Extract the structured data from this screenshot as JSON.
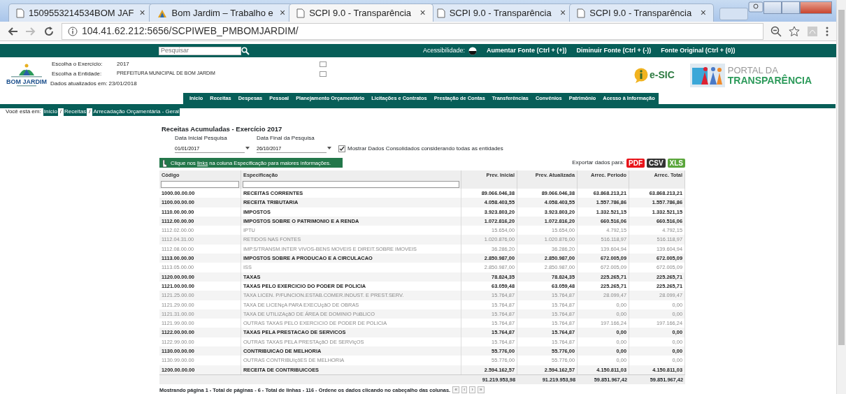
{
  "browser": {
    "tabs": [
      {
        "label": "1509553214534BOM JAF",
        "selected": false
      },
      {
        "label": "Bom Jardim – Trabalho e",
        "selected": false
      },
      {
        "label": "SCPI 9.0 - Transparência",
        "selected": true
      },
      {
        "label": "SCPI 9.0 - Transparência",
        "selected": false
      },
      {
        "label": "SCPI 9.0 - Transparência",
        "selected": false
      }
    ],
    "close_glyph": "×",
    "address": "104.41.62.212:5656/SCPIWEB_PMBOMJARDIM/"
  },
  "topbar": {
    "search_placeholder": "Pesquisar",
    "accessibility_label": "Acessibilidade:",
    "font_links": [
      "Aumentar Fonte (Ctrl + (+))",
      "Diminuir Fonte (Ctrl + (-))",
      "Fonte Original (Ctrl + (0))"
    ]
  },
  "header": {
    "logo_title": "BOM JARDIM",
    "fields": [
      {
        "label": "Escolha o Exercício:",
        "value": "2017"
      },
      {
        "label": "Escolha a Entidade:",
        "value": "PREFEITURA MUNICIPAL DE BOM JARDIM"
      }
    ],
    "updated": "Dados atualizados em: 23/01/2018",
    "esic": "e-SIC",
    "portal": [
      "PORTAL DA",
      "TRANSPARÊNCIA"
    ]
  },
  "nav": [
    "Inicio",
    "Receitas",
    "Despesas",
    "Pessoal",
    "Planejamento Orçamentário",
    "Licitações e Contratos",
    "Prestação de Contas",
    "Transferências",
    "Convênios",
    "Patrimônio",
    "Acesso à Informação"
  ],
  "breadcrumb": {
    "label": "Você está em:",
    "separator": "/",
    "items": [
      "Início",
      "Receitas",
      "Arrecadação Orçamentária - Geral"
    ]
  },
  "report": {
    "title": "Receitas Acumuladas - Exercício 2017",
    "date_fields": [
      {
        "label": "Data Inicial Pesquisa",
        "value": "01/01/2017"
      },
      {
        "label": "Data Final da Pesquisa",
        "value": "26/10/2017"
      }
    ],
    "consolidated": {
      "label": "Mostrar Dados Consolidados considerando todas as entidades",
      "checked": true
    },
    "hint": "Clique nos **links** na coluna Especificação para maiores informações.",
    "export_label": "Exportar dados para:",
    "export_buttons": [
      {
        "label": "PDF",
        "color": "#e8151b"
      },
      {
        "label": "CSV",
        "color": "#333333"
      },
      {
        "label": "XLS",
        "color": "#5ba63c"
      }
    ]
  },
  "table": {
    "columns": [
      "Código",
      "Especificação",
      "Prev. Inicial",
      "Prev. Atualizada",
      "Arrec. Periodo",
      "Arrec. Total"
    ],
    "rows": [
      {
        "kind": "summary",
        "cells": [
          "1000.00.00.00",
          "RECEITAS CORRENTES",
          "89.066.046,38",
          "89.066.046,38",
          "63.868.213,21",
          "63.868.213,21"
        ]
      },
      {
        "kind": "summary",
        "cells": [
          "1100.00.00.00",
          "RECEITA TRIBUTARIA",
          "4.058.403,55",
          "4.058.403,55",
          "1.557.786,86",
          "1.557.786,86"
        ]
      },
      {
        "kind": "summary",
        "cells": [
          "1110.00.00.00",
          "IMPOSTOS",
          "3.923.803,20",
          "3.923.803,20",
          "1.332.521,15",
          "1.332.521,15"
        ]
      },
      {
        "kind": "summary",
        "cells": [
          "1112.00.00.00",
          "IMPOSTOS SOBRE O PATRIMONIO E A RENDA",
          "1.072.816,20",
          "1.072.816,20",
          "660.516,06",
          "660.516,06"
        ]
      },
      {
        "kind": "detail",
        "cells": [
          "1112.02.00.00",
          "IPTU",
          "15.654,00",
          "15.654,00",
          "4.792,15",
          "4.792,15"
        ]
      },
      {
        "kind": "detail",
        "cells": [
          "1112.04.31.00",
          "RETIDOS NAS FONTES",
          "1.020.876,00",
          "1.020.876,00",
          "516.118,97",
          "516.118,97"
        ]
      },
      {
        "kind": "detail",
        "cells": [
          "1112.08.00.00",
          "IMP.S/TRANSM.INTER VIVOS-BENS MOVEIS E DIREIT.SOBRE IMOVEIS",
          "36.286,20",
          "36.286,20",
          "139.604,94",
          "139.604,94"
        ]
      },
      {
        "kind": "summary",
        "cells": [
          "1113.00.00.00",
          "IMPOSTOS SOBRE A PRODUCAO E A CIRCULACAO",
          "2.850.987,00",
          "2.850.987,00",
          "672.005,09",
          "672.005,09"
        ]
      },
      {
        "kind": "detail",
        "cells": [
          "1113.05.00.00",
          "ISS",
          "2.850.987,00",
          "2.850.987,00",
          "672.005,09",
          "672.005,09"
        ]
      },
      {
        "kind": "summary",
        "cells": [
          "1120.00.00.00",
          "TAXAS",
          "78.824,35",
          "78.824,35",
          "225.265,71",
          "225.265,71"
        ]
      },
      {
        "kind": "summary",
        "cells": [
          "1121.00.00.00",
          "TAXAS PELO EXERCICIO DO PODER DE POLICIA",
          "63.059,48",
          "63.059,48",
          "225.265,71",
          "225.265,71"
        ]
      },
      {
        "kind": "detail",
        "cells": [
          "1121.25.00.00",
          "TAXA LICEN. P/FUNCION.ESTAB.COMER.INDUST. E PREST.SERV.",
          "15.764,87",
          "15.764,87",
          "28.099,47",
          "28.099,47"
        ]
      },
      {
        "kind": "detail",
        "cells": [
          "1121.29.00.00",
          "TAXA DE LICENçA PARA EXECUçãO DE OBRAS",
          "15.764,87",
          "15.764,87",
          "0,00",
          "0,00"
        ]
      },
      {
        "kind": "detail",
        "cells": [
          "1121.31.00.00",
          "TAXA DE UTILIZAçãO DE ÁREA DE DOMINIO PúBLICO",
          "15.764,87",
          "15.764,87",
          "0,00",
          "0,00"
        ]
      },
      {
        "kind": "detail",
        "cells": [
          "1121.99.00.00",
          "OUTRAS TAXAS PELO EXERCICIO DE PODER DE POLICIA",
          "15.764,87",
          "15.764,87",
          "197.166,24",
          "197.166,24"
        ]
      },
      {
        "kind": "summary",
        "cells": [
          "1122.00.00.00",
          "TAXAS PELA PRESTACAO DE SERVICOS",
          "15.764,87",
          "15.764,87",
          "0,00",
          "0,00"
        ]
      },
      {
        "kind": "detail",
        "cells": [
          "1122.99.00.00",
          "OUTRAS TAXAS PELA PRESTAçãO DE SERVIçOS",
          "15.764,87",
          "15.764,87",
          "0,00",
          "0,00"
        ]
      },
      {
        "kind": "summary",
        "cells": [
          "1130.00.00.00",
          "CONTRIBUICAO DE MELHORIA",
          "55.776,00",
          "55.776,00",
          "0,00",
          "0,00"
        ]
      },
      {
        "kind": "detail",
        "cells": [
          "1130.99.00.00",
          "OUTRAS CONTRIBUIçõES DE MELHORIA",
          "55.776,00",
          "55.776,00",
          "0,00",
          "0,00"
        ]
      },
      {
        "kind": "summary",
        "cells": [
          "1200.00.00.00",
          "RECEITA DE CONTRIBUICOES",
          "2.594.162,57",
          "2.594.162,57",
          "4.150.811,03",
          "4.150.811,03"
        ]
      }
    ],
    "totals": [
      "91.219.953,98",
      "91.219.953,98",
      "59.851.967,42",
      "59.851.967,42"
    ],
    "footer": "Mostrando página 1 - Total de páginas - 6 - Total de linhas - 116 - Ordene os dados clicando no cabeçalho das colunas.",
    "pager": [
      "«",
      "‹",
      "›",
      "»"
    ]
  }
}
